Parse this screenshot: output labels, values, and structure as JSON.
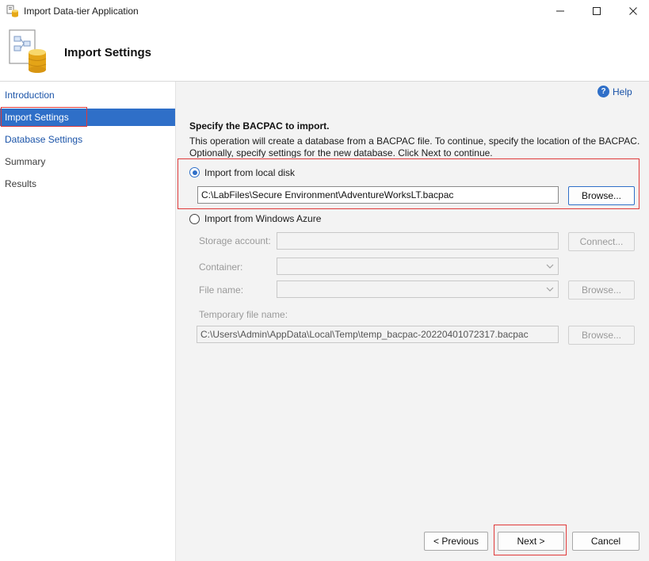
{
  "window": {
    "title": "Import Data-tier Application"
  },
  "header": {
    "title": "Import Settings"
  },
  "sidebar": {
    "items": [
      {
        "label": "Introduction"
      },
      {
        "label": "Import Settings"
      },
      {
        "label": "Database Settings"
      },
      {
        "label": "Summary"
      },
      {
        "label": "Results"
      }
    ]
  },
  "main": {
    "help_label": "Help",
    "section_title": "Specify the BACPAC to import.",
    "description": "This operation will create a database from a BACPAC file. To continue, specify the location of the BACPAC. Optionally, specify settings for the new database. Click Next to continue.",
    "local": {
      "label": "Import from local disk",
      "path": "C:\\LabFiles\\Secure Environment\\AdventureWorksLT.bacpac",
      "browse_label": "Browse..."
    },
    "azure": {
      "label": "Import from Windows Azure",
      "storage_label": "Storage account:",
      "connect_label": "Connect...",
      "container_label": "Container:",
      "filename_label": "File name:",
      "filename_browse_label": "Browse...",
      "temp_label": "Temporary file name:",
      "temp_path": "C:\\Users\\Admin\\AppData\\Local\\Temp\\temp_bacpac-20220401072317.bacpac",
      "temp_browse_label": "Browse..."
    }
  },
  "footer": {
    "previous_label": "< Previous",
    "next_label": "Next >",
    "cancel_label": "Cancel"
  }
}
